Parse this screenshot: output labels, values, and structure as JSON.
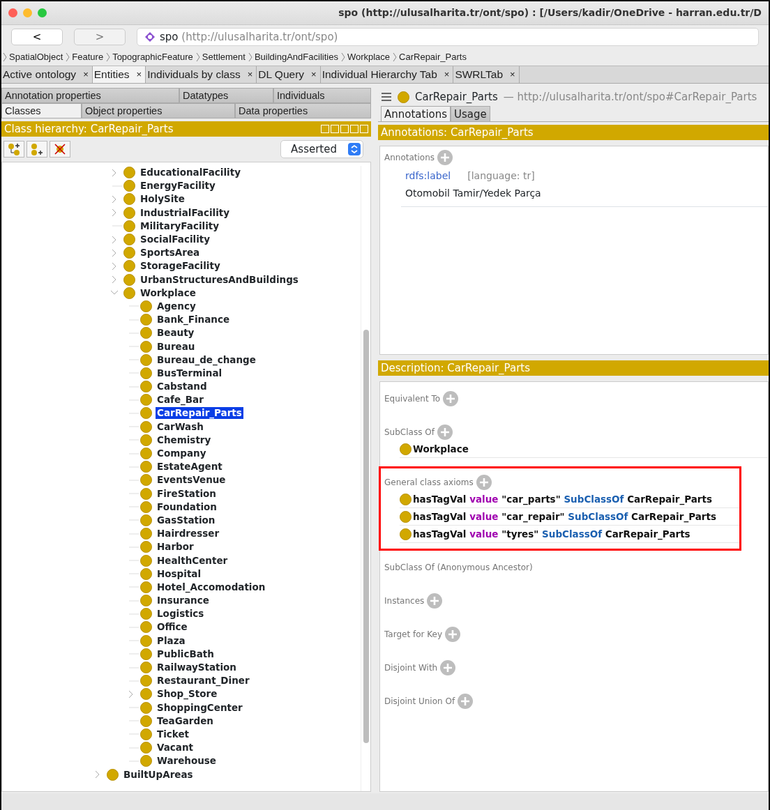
{
  "window": {
    "title": "spo (http://ulusalharita.tr/ont/spo)  : [/Users/kadir/OneDrive - harran.edu.tr/D"
  },
  "nav": {
    "back": "<",
    "forward": ">",
    "ontology": "spo",
    "iri": "(http://ulusalharita.tr/ont/spo)"
  },
  "breadcrumb": [
    "SpatialObject",
    "Feature",
    "TopographicFeature",
    "Settlement",
    "BuildingAndFacilities",
    "Workplace",
    "CarRepair_Parts"
  ],
  "tabs": [
    {
      "label": "Active ontology",
      "close": "×",
      "selected": false
    },
    {
      "label": "Entities",
      "close": "×",
      "selected": true
    },
    {
      "label": "Individuals by class",
      "close": "×",
      "selected": false
    },
    {
      "label": "DL Query",
      "close": "×",
      "selected": false
    },
    {
      "label": "Individual Hierarchy Tab",
      "close": "×",
      "selected": false
    },
    {
      "label": "SWRLTab",
      "close": "×",
      "selected": false
    }
  ],
  "entity_tab_rows": [
    [
      {
        "label": "Annotation properties",
        "selected": false
      },
      {
        "label": "Datatypes",
        "selected": false
      },
      {
        "label": "Individuals",
        "selected": false
      }
    ],
    [
      {
        "label": "Classes",
        "selected": true
      },
      {
        "label": "Object properties",
        "selected": false
      },
      {
        "label": "Data properties",
        "selected": false
      }
    ]
  ],
  "class_hierarchy": {
    "title": "Class hierarchy: CarRepair_Parts",
    "mode": "Asserted",
    "tree": [
      {
        "children": [
          {
            "label": "EducationalFacility",
            "expanded": false,
            "selected": false
          },
          {
            "label": "EnergyFacility",
            "selected": false
          },
          {
            "label": "HolySite",
            "expanded": false,
            "selected": false
          },
          {
            "label": "IndustrialFacility",
            "expanded": false,
            "selected": false
          },
          {
            "label": "MilitaryFacility",
            "selected": false
          },
          {
            "label": "SocialFacility",
            "expanded": false,
            "selected": false
          },
          {
            "label": "SportsArea",
            "expanded": false,
            "selected": false
          },
          {
            "label": "StorageFacility",
            "expanded": false,
            "selected": false
          },
          {
            "label": "UrbanStructuresAndBuildings",
            "expanded": false,
            "selected": false
          },
          {
            "label": "Workplace",
            "expanded": true,
            "selected": false,
            "children": [
              {
                "label": "Agency",
                "selected": false
              },
              {
                "label": "Bank_Finance",
                "selected": false
              },
              {
                "label": "Beauty",
                "selected": false
              },
              {
                "label": "Bureau",
                "selected": false
              },
              {
                "label": "Bureau_de_change",
                "selected": false
              },
              {
                "label": "BusTerminal",
                "selected": false
              },
              {
                "label": "Cabstand",
                "selected": false
              },
              {
                "label": "Cafe_Bar",
                "selected": false
              },
              {
                "label": "CarRepair_Parts",
                "selected": true
              },
              {
                "label": "CarWash",
                "selected": false
              },
              {
                "label": "Chemistry",
                "selected": false
              },
              {
                "label": "Company",
                "selected": false
              },
              {
                "label": "EstateAgent",
                "selected": false
              },
              {
                "label": "EventsVenue",
                "selected": false
              },
              {
                "label": "FireStation",
                "selected": false
              },
              {
                "label": "Foundation",
                "selected": false
              },
              {
                "label": "GasStation",
                "selected": false
              },
              {
                "label": "Hairdresser",
                "selected": false
              },
              {
                "label": "Harbor",
                "selected": false
              },
              {
                "label": "HealthCenter",
                "selected": false
              },
              {
                "label": "Hospital",
                "selected": false
              },
              {
                "label": "Hotel_Accomodation",
                "selected": false
              },
              {
                "label": "Insurance",
                "selected": false
              },
              {
                "label": "Logistics",
                "selected": false
              },
              {
                "label": "Office",
                "selected": false
              },
              {
                "label": "Plaza",
                "selected": false
              },
              {
                "label": "PublicBath",
                "selected": false
              },
              {
                "label": "RailwayStation",
                "selected": false
              },
              {
                "label": "Restaurant_Diner",
                "selected": false
              },
              {
                "label": "Shop_Store",
                "expanded": false,
                "selected": false
              },
              {
                "label": "ShoppingCenter",
                "selected": false
              },
              {
                "label": "TeaGarden",
                "selected": false
              },
              {
                "label": "Ticket",
                "selected": false
              },
              {
                "label": "Vacant",
                "selected": false
              },
              {
                "label": "Warehouse",
                "selected": false
              }
            ]
          }
        ]
      },
      {
        "label": "BuiltUpAreas",
        "expanded": false,
        "selected": false
      }
    ]
  },
  "entity": {
    "name": "CarRepair_Parts",
    "iri": "— http://ulusalharita.tr/ont/spo#CarRepair_Parts"
  },
  "detail_tabs": [
    {
      "label": "Annotations",
      "selected": true
    },
    {
      "label": "Usage",
      "selected": false
    }
  ],
  "annotations": {
    "title": "Annotations: CarRepair_Parts",
    "section": "Annotations",
    "items": [
      {
        "property": "rdfs:label",
        "language": "[language: tr]",
        "value": "Otomobil Tamir/Yedek Parça"
      }
    ]
  },
  "description": {
    "title": "Description: CarRepair_Parts",
    "sections": [
      {
        "label": "Equivalent To",
        "addable": true,
        "highlighted": false
      },
      {
        "label": "SubClass Of",
        "addable": true,
        "highlighted": false,
        "items": [
          {
            "tokens": [
              {
                "text": "Workplace",
                "kind": "entity"
              }
            ]
          }
        ]
      },
      {
        "label": "General class axioms",
        "addable": true,
        "highlighted": true,
        "items": [
          {
            "tokens": [
              {
                "text": "hasTagVal",
                "kind": "entity"
              },
              {
                "text": "value",
                "kind": "keyword"
              },
              {
                "text": "\"car_parts\"",
                "kind": "literal"
              },
              {
                "text": "SubClassOf",
                "kind": "axiom"
              },
              {
                "text": "CarRepair_Parts",
                "kind": "entity"
              }
            ]
          },
          {
            "tokens": [
              {
                "text": "hasTagVal",
                "kind": "entity"
              },
              {
                "text": "value",
                "kind": "keyword"
              },
              {
                "text": "\"car_repair\"",
                "kind": "literal"
              },
              {
                "text": "SubClassOf",
                "kind": "axiom"
              },
              {
                "text": "CarRepair_Parts",
                "kind": "entity"
              }
            ]
          },
          {
            "tokens": [
              {
                "text": "hasTagVal",
                "kind": "entity"
              },
              {
                "text": "value",
                "kind": "keyword"
              },
              {
                "text": "\"tyres\"",
                "kind": "literal"
              },
              {
                "text": "SubClassOf",
                "kind": "axiom"
              },
              {
                "text": "CarRepair_Parts",
                "kind": "entity"
              }
            ]
          }
        ]
      },
      {
        "label": "SubClass Of (Anonymous Ancestor)",
        "addable": false,
        "highlighted": false
      },
      {
        "label": "Instances",
        "addable": true,
        "highlighted": false
      },
      {
        "label": "Target for Key",
        "addable": true,
        "highlighted": false
      },
      {
        "label": "Disjoint With",
        "addable": true,
        "highlighted": false
      },
      {
        "label": "Disjoint Union Of",
        "addable": true,
        "highlighted": false
      }
    ]
  }
}
